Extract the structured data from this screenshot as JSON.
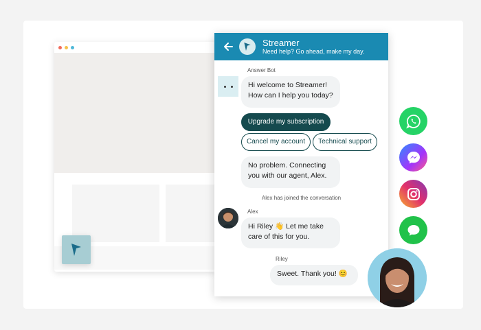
{
  "widget": {
    "title": "Streamer",
    "subtitle": "Need help? Go ahead, make my day."
  },
  "conversation": {
    "bot_name": "Answer Bot",
    "bot_greeting_1": "Hi welcome to Streamer!",
    "bot_greeting_2": "How can I help you today?",
    "options": [
      "Upgrade my subscription",
      "Cancel my account",
      "Technical support"
    ],
    "bot_reply_1": "No problem. Connecting",
    "bot_reply_2": "you with our agent, Alex.",
    "system_message": "Alex has joined the conversation",
    "agent_name": "Alex",
    "agent_message_1": "Hi Riley 👋 Let me take",
    "agent_message_2": "care of this for you.",
    "user_name": "Riley",
    "user_message": "Sweet. Thank you! 😊"
  },
  "channels": [
    "whatsapp-icon",
    "messenger-icon",
    "instagram-icon",
    "messages-icon"
  ],
  "colors": {
    "header": "#1a8ab2",
    "chip_dark": "#154a4e",
    "whatsapp": "#25d366",
    "messenger": "#7b4bf0",
    "instagram": "#d6266f",
    "messages": "#21c24a"
  }
}
